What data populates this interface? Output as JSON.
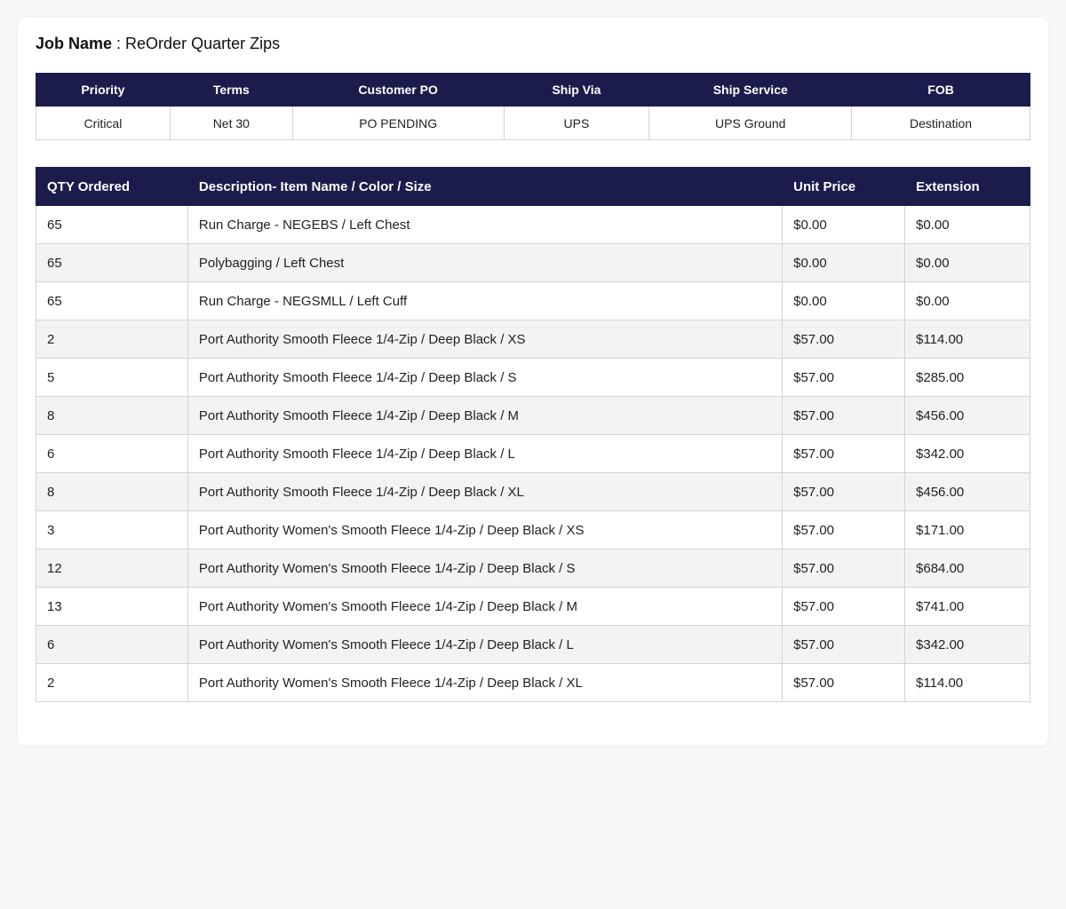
{
  "job": {
    "label": "Job Name",
    "separator": " : ",
    "name": "ReOrder Quarter Zips"
  },
  "meta": {
    "headers": [
      "Priority",
      "Terms",
      "Customer PO",
      "Ship Via",
      "Ship Service",
      "FOB"
    ],
    "values": [
      "Critical",
      "Net 30",
      "PO PENDING",
      "UPS",
      "UPS Ground",
      "Destination"
    ]
  },
  "items": {
    "headers": [
      "QTY Ordered",
      "Description- Item Name / Color / Size",
      "Unit Price",
      "Extension"
    ],
    "rows": [
      [
        "65",
        "Run Charge - NEGEBS / Left Chest",
        "$0.00",
        "$0.00"
      ],
      [
        "65",
        "Polybagging / Left Chest",
        "$0.00",
        "$0.00"
      ],
      [
        "65",
        "Run Charge - NEGSMLL / Left Cuff",
        "$0.00",
        "$0.00"
      ],
      [
        "2",
        "Port Authority Smooth Fleece 1/4-Zip / Deep Black / XS",
        "$57.00",
        "$114.00"
      ],
      [
        "5",
        "Port Authority Smooth Fleece 1/4-Zip / Deep Black / S",
        "$57.00",
        "$285.00"
      ],
      [
        "8",
        "Port Authority Smooth Fleece 1/4-Zip / Deep Black / M",
        "$57.00",
        "$456.00"
      ],
      [
        "6",
        "Port Authority Smooth Fleece 1/4-Zip / Deep Black / L",
        "$57.00",
        "$342.00"
      ],
      [
        "8",
        "Port Authority Smooth Fleece 1/4-Zip / Deep Black / XL",
        "$57.00",
        "$456.00"
      ],
      [
        "3",
        "Port Authority Women's Smooth Fleece 1/4-Zip / Deep Black / XS",
        "$57.00",
        "$171.00"
      ],
      [
        "12",
        "Port Authority Women's Smooth Fleece 1/4-Zip / Deep Black / S",
        "$57.00",
        "$684.00"
      ],
      [
        "13",
        "Port Authority Women's Smooth Fleece 1/4-Zip / Deep Black / M",
        "$57.00",
        "$741.00"
      ],
      [
        "6",
        "Port Authority Women's Smooth Fleece 1/4-Zip / Deep Black / L",
        "$57.00",
        "$342.00"
      ],
      [
        "2",
        "Port Authority Women's Smooth Fleece 1/4-Zip / Deep Black / XL",
        "$57.00",
        "$114.00"
      ]
    ]
  },
  "colors": {
    "header_bg": "#1c1c4c",
    "header_text": "#ffffff",
    "stripe": "#f3f3f3",
    "page_bg": "#f8f8f8"
  }
}
